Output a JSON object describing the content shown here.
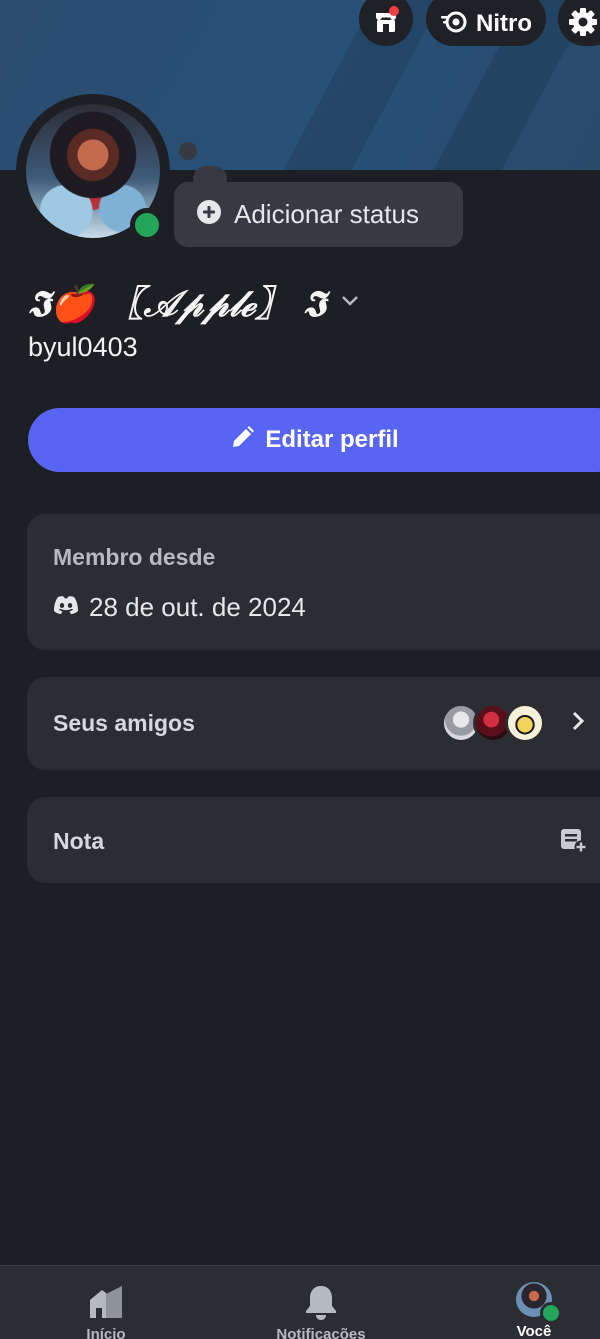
{
  "header": {
    "nitro_label": "Nitro",
    "icons": [
      "shop-icon",
      "nitro-icon",
      "gear-icon"
    ],
    "banner_color": "#285078",
    "notification_dot_color": "#f23f43"
  },
  "profile": {
    "display_name": "𝕴🍎 〖𝒜𝓅𝓅𝓁ℯ〗 𝕴",
    "username": "byul0403",
    "status_prompt": "Adicionar status",
    "presence_color": "#23a55a"
  },
  "actions": {
    "edit_profile": "Editar perfil",
    "accent_color": "#5865f2"
  },
  "member_since": {
    "title": "Membro desde",
    "date": "28 de out. de 2024",
    "icon": "discord-icon"
  },
  "friends": {
    "label": "Seus amigos",
    "avatar_count": 3
  },
  "note": {
    "label": "Nota",
    "icon": "add-note-icon"
  },
  "bottom_nav": {
    "items": [
      {
        "label": "Início",
        "icon": "home-icon"
      },
      {
        "label": "Notificações",
        "icon": "bell-icon"
      },
      {
        "label": "Você",
        "icon": "avatar"
      }
    ]
  }
}
